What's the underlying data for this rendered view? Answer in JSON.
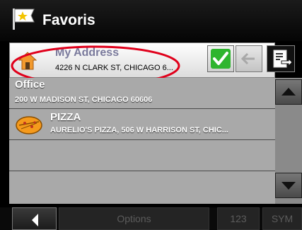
{
  "header": {
    "title": "Favoris"
  },
  "selected_address": {
    "name": "My Address",
    "street": "4226 N CLARK ST, CHICAGO 6..."
  },
  "favorites": [
    {
      "title": "Office",
      "subtitle": "200 W MADISON ST, CHICAGO 60606",
      "icon": "none"
    },
    {
      "title": "PIZZA",
      "subtitle": "AURELIO'S PIZZA, 506 W HARRISON ST, CHIC...",
      "icon": "pizza-icon"
    }
  ],
  "bottom_bar": {
    "options_label": "Options",
    "numeric_label": "123",
    "symbol_label": "SYM"
  },
  "colors": {
    "accent_green": "#2fb52f",
    "highlight_red": "#e0001b",
    "list_gray": "#a9a9a9"
  }
}
